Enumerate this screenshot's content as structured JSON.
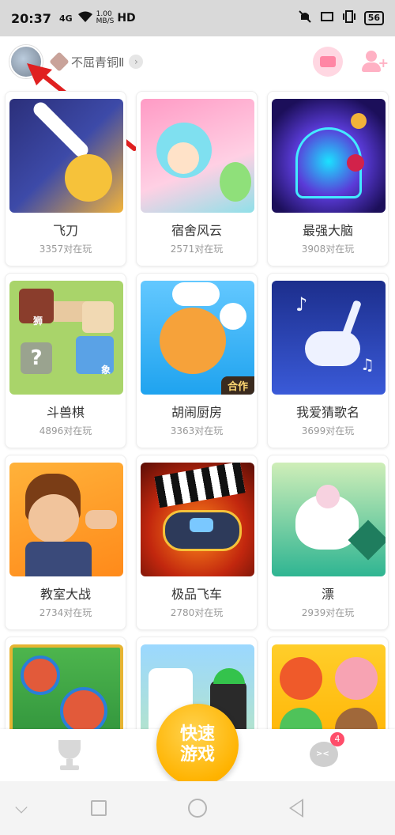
{
  "status": {
    "time": "20:37",
    "net_type": "4G",
    "speed_value": "1.00",
    "speed_unit": "MB/S",
    "hd": "HD",
    "battery": "56"
  },
  "header": {
    "rank_label": "不屈青铜Ⅱ",
    "avatar_icon": "avatar-icon",
    "wallet_icon": "wallet-icon",
    "add_friend_icon": "add-friend-icon",
    "accent_color": "#ff86a4"
  },
  "games": [
    {
      "title": "飞刀",
      "players": "3357对在玩"
    },
    {
      "title": "宿舍风云",
      "players": "2571对在玩"
    },
    {
      "title": "最强大脑",
      "players": "3908对在玩"
    },
    {
      "title": "斗兽棋",
      "players": "4896对在玩"
    },
    {
      "title": "胡闹厨房",
      "players": "3363对在玩",
      "tag": "合作"
    },
    {
      "title": "我爱猜歌名",
      "players": "3699对在玩"
    },
    {
      "title": "教室大战",
      "players": "2734对在玩"
    },
    {
      "title": "极品飞车",
      "players": "2780对在玩"
    },
    {
      "title": "漂",
      "players": "2939对在玩"
    },
    {
      "title": "",
      "players": ""
    },
    {
      "title": "",
      "players": ""
    },
    {
      "title": "",
      "players": ""
    }
  ],
  "doushou_labels": {
    "lion": "狮",
    "elephant": "象",
    "question": "?"
  },
  "bottom_nav": {
    "quick_line1": "快速",
    "quick_line2": "游戏",
    "chat_badge": "4",
    "brand_color": "#ffb300"
  }
}
